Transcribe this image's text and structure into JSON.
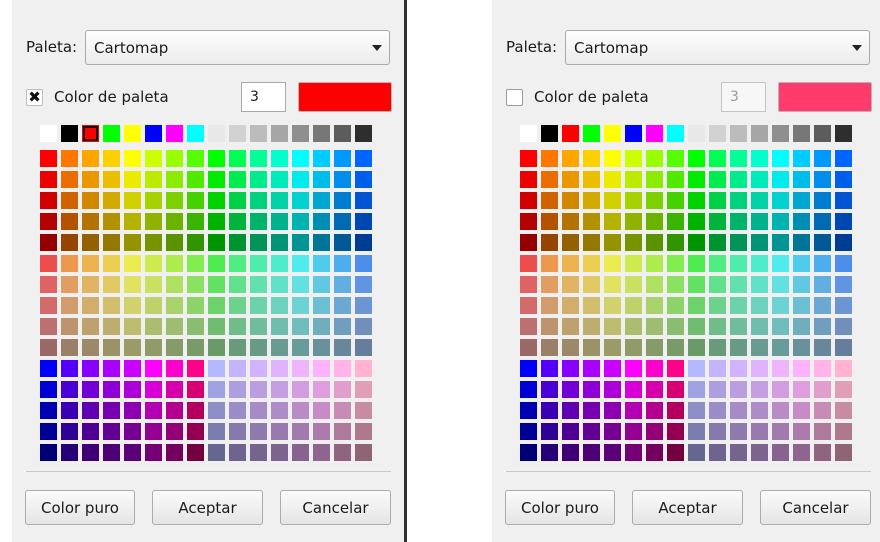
{
  "dialogs": [
    {
      "palette_label": "Paleta:",
      "palette_value": "Cartomap",
      "palette_color_checkbox_label": "Color de paleta",
      "palette_color_checked": true,
      "palette_index": "3",
      "selected_color": "#ff0000",
      "selected_cell": "top-row-3",
      "buttons": {
        "pure_color": "Color puro",
        "accept": "Aceptar",
        "cancel": "Cancelar"
      }
    },
    {
      "palette_label": "Paleta:",
      "palette_value": "Cartomap",
      "palette_color_checkbox_label": "Color de paleta",
      "palette_color_checked": false,
      "palette_index": "3",
      "selected_color": "#ff3b6e",
      "selected_cell": null,
      "buttons": {
        "pure_color": "Color puro",
        "accept": "Aceptar",
        "cancel": "Cancelar"
      }
    }
  ],
  "palette": {
    "top_row": [
      "#ffffff",
      "#000000",
      "#ff0000",
      "#00ff00",
      "#ffff00",
      "#0000ff",
      "#ff00ff",
      "#00ffff",
      "#e8e8e8",
      "#d2d2d2",
      "#bcbcbc",
      "#a6a6a6",
      "#8f8f8f",
      "#777777",
      "#5c5c5c",
      "#2e2e2e"
    ],
    "hue_row": [
      "#ff0000",
      "#ff7700",
      "#ffa500",
      "#ffd000",
      "#ffff00",
      "#ccff00",
      "#99ff00",
      "#55ff00",
      "#00ff00",
      "#00ff55",
      "#00ff99",
      "#00ffcc",
      "#00ffff",
      "#00ccff",
      "#0099ff",
      "#0066ff"
    ],
    "dark_factors": [
      1.0,
      0.92,
      0.82,
      0.7,
      0.58
    ],
    "pastel_blend": [
      0.62,
      0.5,
      0.4,
      0.3,
      0.2
    ],
    "pastel_grey": [
      205,
      195,
      180,
      160,
      130
    ],
    "purple_row": [
      "#0000ff",
      "#5500ff",
      "#8800ff",
      "#aa00ff",
      "#cc00ff",
      "#ff00ff",
      "#ff00cc",
      "#ff0088",
      "#b3b8ff",
      "#c5b3ff",
      "#d3b3ff",
      "#e0b3ff",
      "#efb3ff",
      "#ffb3ff",
      "#ffb3e6",
      "#ffb3d0"
    ],
    "purple_factors": [
      1.0,
      0.84,
      0.7,
      0.58,
      0.46
    ],
    "purple_grey_factors": [
      1.0,
      0.88,
      0.78,
      0.68,
      0.56
    ]
  }
}
